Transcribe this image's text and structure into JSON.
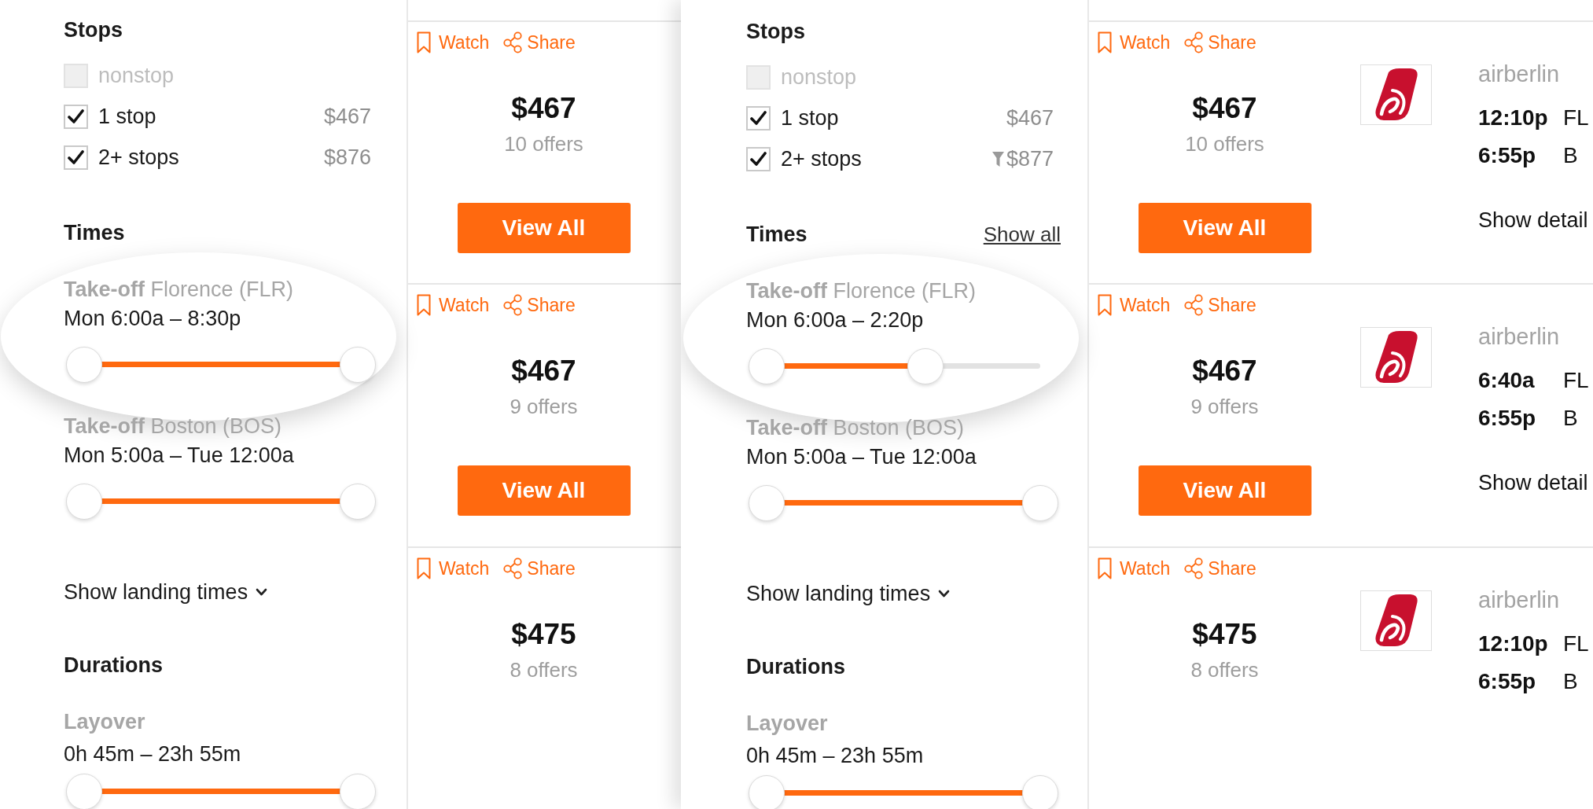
{
  "panels": [
    {
      "filters": {
        "stops": {
          "title": "Stops",
          "options": [
            {
              "label": "nonstop",
              "checked": false,
              "disabled": true,
              "filtered": false
            },
            {
              "label": "1 stop",
              "checked": true,
              "disabled": false,
              "filtered": false,
              "price": "$467"
            },
            {
              "label": "2+ stops",
              "checked": true,
              "disabled": false,
              "filtered": false,
              "price": "$876"
            }
          ]
        },
        "times": {
          "title": "Times",
          "sliders": [
            {
              "label": "**Take-off** Florence (FLR)",
              "range": "Mon 6:00a – 8:30p",
              "level": 1,
              "magnified": true
            },
            {
              "label": "**Take-off** Boston (BOS)",
              "range": "Mon 5:00a – Tue 12:00a",
              "level": 1,
              "magnified": false
            }
          ],
          "toggle": "Show landing times"
        },
        "durations": {
          "title": "Durations",
          "sliders": [
            {
              "label": "Layover",
              "range": "0h 45m – 23h 55m",
              "level": 1,
              "magnified": false
            }
          ]
        }
      },
      "results": [
        {
          "watch": "Watch",
          "share": "Share",
          "price": "$467",
          "offers": "10 offers",
          "button": "View All"
        },
        {
          "watch": "Watch",
          "share": "Share",
          "price": "$467",
          "offers": "9 offers",
          "button": "View All"
        },
        {
          "watch": "Watch",
          "share": "Share",
          "price": "$475",
          "offers": "8 offers"
        }
      ]
    },
    {
      "filters": {
        "stops": {
          "title": "Stops",
          "options": [
            {
              "label": "nonstop",
              "checked": false,
              "disabled": true,
              "filtered": false
            },
            {
              "label": "1 stop",
              "checked": true,
              "disabled": false,
              "filtered": false,
              "price": "$467"
            },
            {
              "label": "2+ stops",
              "checked": true,
              "disabled": false,
              "filtered": true,
              "price": "$877"
            }
          ]
        },
        "times": {
          "title": "Times",
          "show_all": "Show all",
          "sliders": [
            {
              "label": "**Take-off** Florence (FLR)",
              "range": "Mon 6:00a – 2:20p",
              "level": 0.58,
              "magnified": true
            },
            {
              "label": "**Take-off** Boston (BOS)",
              "range": "Mon 5:00a – Tue 12:00a",
              "level": 1,
              "magnified": false
            }
          ],
          "toggle": "Show landing times"
        },
        "durations": {
          "title": "Durations",
          "sliders": [
            {
              "label": "Layover",
              "range": "0h 45m – 23h 55m",
              "level": 1,
              "magnified": false
            }
          ]
        }
      },
      "results": [
        {
          "watch": "Watch",
          "share": "Share",
          "price": "$467",
          "offers": "10 offers",
          "button": "View All",
          "flight": {
            "airline": "airberlin",
            "legs": [
              {
                "time": "12:10p",
                "airport": "FL"
              },
              {
                "time": "6:55p",
                "airport": "B"
              }
            ],
            "details": "Show detail"
          }
        },
        {
          "watch": "Watch",
          "share": "Share",
          "price": "$467",
          "offers": "9 offers",
          "button": "View All",
          "flight": {
            "airline": "airberlin",
            "legs": [
              {
                "time": "6:40a",
                "airport": "FL"
              },
              {
                "time": "6:55p",
                "airport": "B"
              }
            ],
            "details": "Show detail"
          }
        },
        {
          "watch": "Watch",
          "share": "Share",
          "price": "$475",
          "offers": "8 offers",
          "flight": {
            "airline": "airberlin",
            "legs": [
              {
                "time": "12:10p",
                "airport": "FL"
              },
              {
                "time": "6:55p",
                "airport": "B"
              }
            ]
          }
        }
      ]
    }
  ]
}
